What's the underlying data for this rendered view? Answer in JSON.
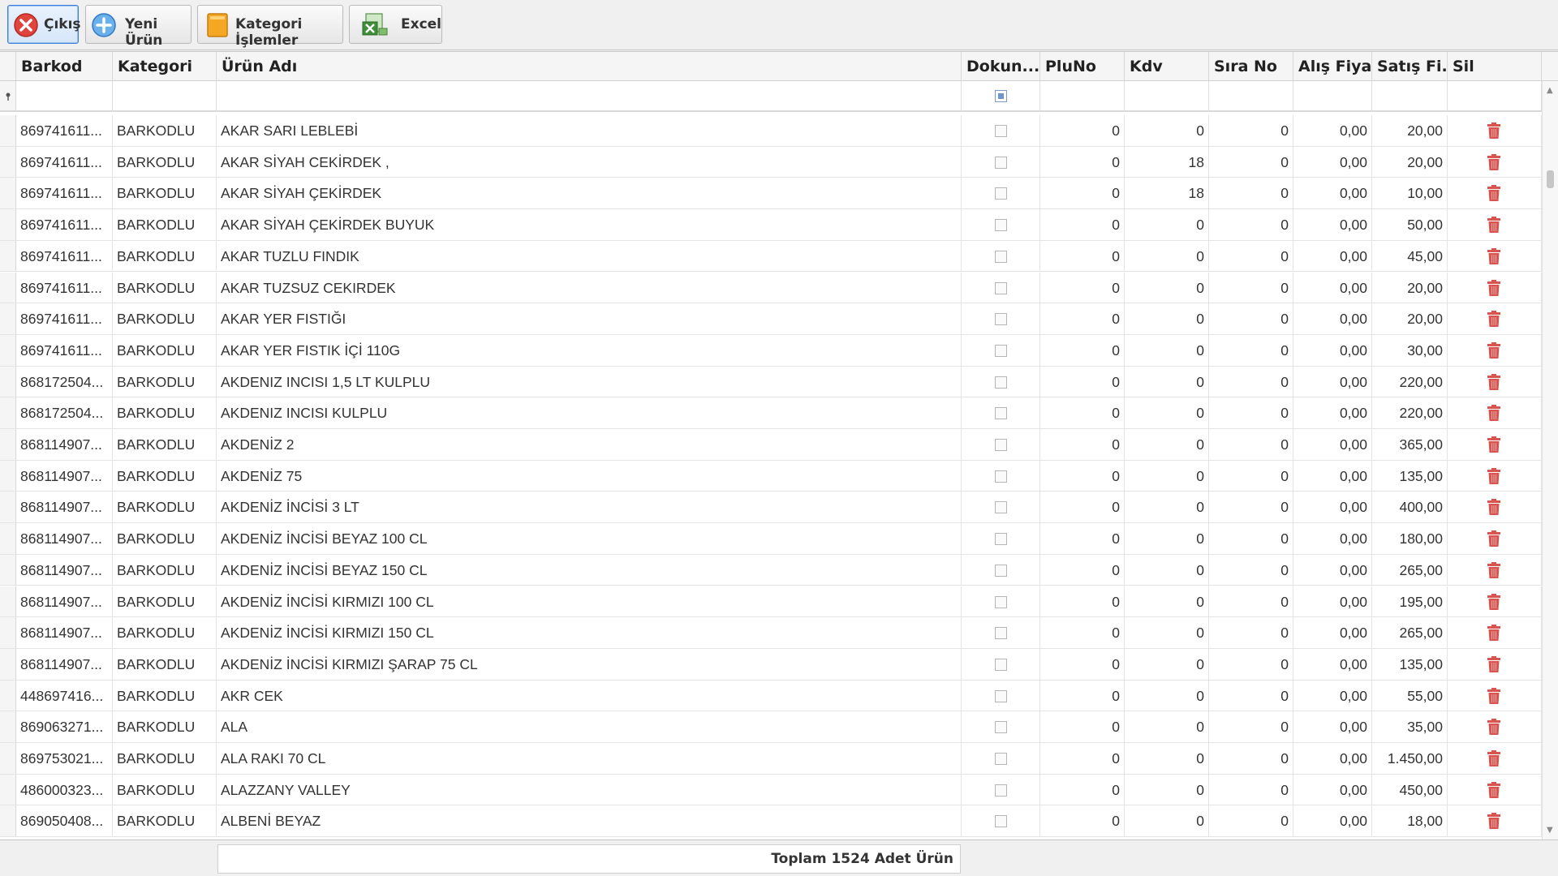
{
  "toolbar": {
    "exit_label": "Çıkış",
    "new_product_label": "Yeni Ürün",
    "category_label": "Kategori İşlemler",
    "excel_label": "Excel"
  },
  "columns": [
    "Barkod",
    "Kategori",
    "Ürün Adı",
    "Dokun...",
    "PluNo",
    "Kdv",
    "Sıra No",
    "Alış Fiyatı",
    "Satış Fi...",
    "Sil"
  ],
  "rows": [
    [
      "869741611...",
      "BARKODLU",
      "AKAR SARI LEBLEBİ",
      "0",
      "0",
      "0",
      "0,00",
      "20,00"
    ],
    [
      "869741611...",
      "BARKODLU",
      "AKAR SİYAH CEKİRDEK ,",
      "0",
      "18",
      "0",
      "0,00",
      "20,00"
    ],
    [
      "869741611...",
      "BARKODLU",
      "AKAR SİYAH ÇEKİRDEK",
      "0",
      "18",
      "0",
      "0,00",
      "10,00"
    ],
    [
      "869741611...",
      "BARKODLU",
      "AKAR SİYAH ÇEKİRDEK BUYUK",
      "0",
      "0",
      "0",
      "0,00",
      "50,00"
    ],
    [
      "869741611...",
      "BARKODLU",
      "AKAR TUZLU FINDIK",
      "0",
      "0",
      "0",
      "0,00",
      "45,00"
    ],
    [
      "869741611...",
      "BARKODLU",
      "AKAR TUZSUZ CEKIRDEK",
      "0",
      "0",
      "0",
      "0,00",
      "20,00"
    ],
    [
      "869741611...",
      "BARKODLU",
      "AKAR YER FISTIĞI",
      "0",
      "0",
      "0",
      "0,00",
      "20,00"
    ],
    [
      "869741611...",
      "BARKODLU",
      "AKAR YER FISTIK İÇİ 110G",
      "0",
      "0",
      "0",
      "0,00",
      "30,00"
    ],
    [
      "868172504...",
      "BARKODLU",
      "AKDENIZ INCISI 1,5 LT KULPLU",
      "0",
      "0",
      "0",
      "0,00",
      "220,00"
    ],
    [
      "868172504...",
      "BARKODLU",
      "AKDENIZ INCISI KULPLU",
      "0",
      "0",
      "0",
      "0,00",
      "220,00"
    ],
    [
      "868114907...",
      "BARKODLU",
      "AKDENİZ 2",
      "0",
      "0",
      "0",
      "0,00",
      "365,00"
    ],
    [
      "868114907...",
      "BARKODLU",
      "AKDENİZ 75",
      "0",
      "0",
      "0",
      "0,00",
      "135,00"
    ],
    [
      "868114907...",
      "BARKODLU",
      "AKDENİZ İNCİSİ 3 LT",
      "0",
      "0",
      "0",
      "0,00",
      "400,00"
    ],
    [
      "868114907...",
      "BARKODLU",
      "AKDENİZ İNCİSİ BEYAZ 100 CL",
      "0",
      "0",
      "0",
      "0,00",
      "180,00"
    ],
    [
      "868114907...",
      "BARKODLU",
      "AKDENİZ İNCİSİ BEYAZ 150 CL",
      "0",
      "0",
      "0",
      "0,00",
      "265,00"
    ],
    [
      "868114907...",
      "BARKODLU",
      "AKDENİZ İNCİSİ KIRMIZI 100 CL",
      "0",
      "0",
      "0",
      "0,00",
      "195,00"
    ],
    [
      "868114907...",
      "BARKODLU",
      "AKDENİZ İNCİSİ KIRMIZI 150 CL",
      "0",
      "0",
      "0",
      "0,00",
      "265,00"
    ],
    [
      "868114907...",
      "BARKODLU",
      "AKDENİZ İNCİSİ KIRMIZI ŞARAP 75 CL",
      "0",
      "0",
      "0",
      "0,00",
      "135,00"
    ],
    [
      "448697416...",
      "BARKODLU",
      "AKR CEK",
      "0",
      "0",
      "0",
      "0,00",
      "55,00"
    ],
    [
      "869063271...",
      "BARKODLU",
      "ALA",
      "0",
      "0",
      "0",
      "0,00",
      "35,00"
    ],
    [
      "869753021...",
      "BARKODLU",
      "ALA RAKI 70 CL",
      "0",
      "0",
      "0",
      "0,00",
      "1.450,00"
    ],
    [
      "486000323...",
      "BARKODLU",
      "ALAZZANY VALLEY",
      "0",
      "0",
      "0",
      "0,00",
      "450,00"
    ],
    [
      "869050408...",
      "BARKODLU",
      "ALBENİ BEYAZ",
      "0",
      "0",
      "0",
      "0,00",
      "18,00"
    ]
  ],
  "footer": {
    "total_label": "Toplam 1524 Adet Ürün"
  },
  "icons": {
    "exit": "close-circle-icon",
    "new": "plus-circle-icon",
    "category": "folder-icon",
    "excel": "excel-icon",
    "delete": "trash-icon",
    "filter": "filter-pin-icon"
  },
  "colors": {
    "accent": "#3b7dd8",
    "delete": "#d9534f",
    "exit": "#e0443c"
  }
}
